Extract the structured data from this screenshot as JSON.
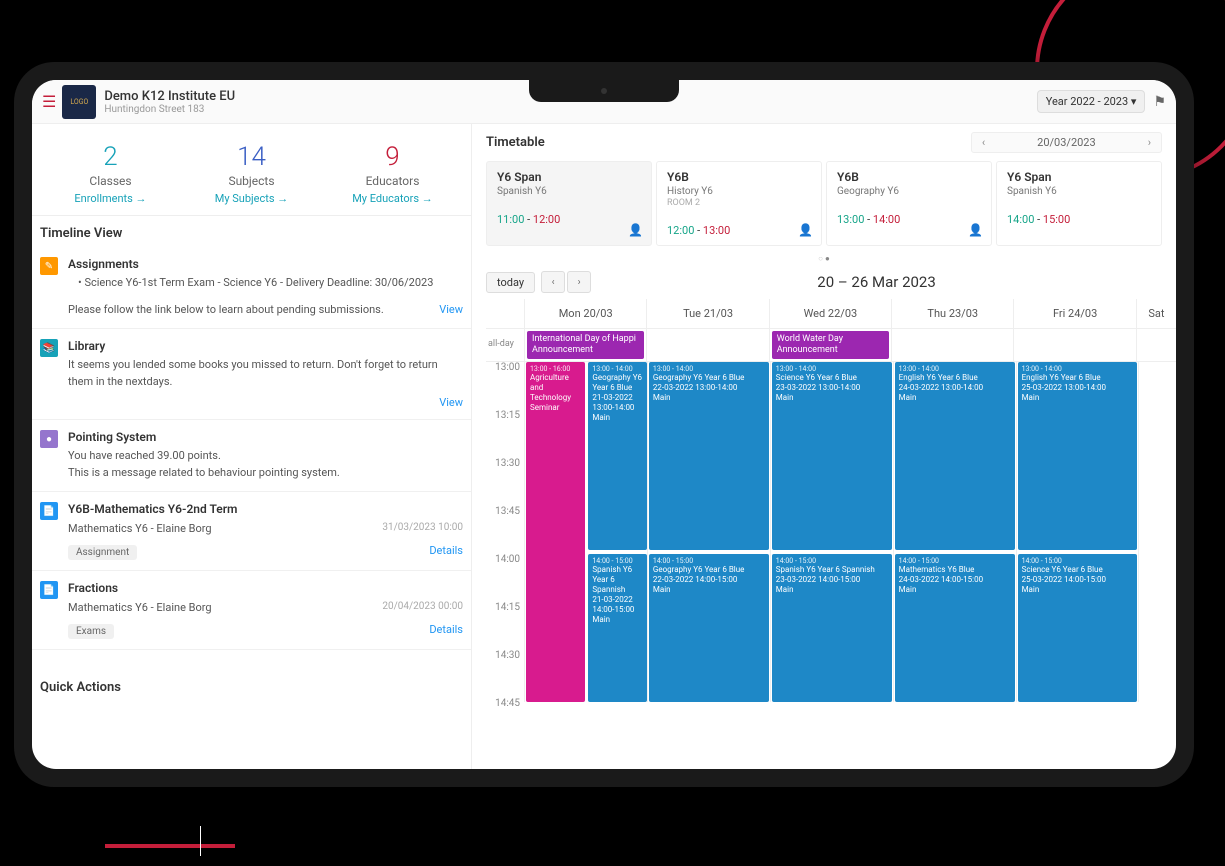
{
  "header": {
    "institute": "Demo K12 Institute EU",
    "address": "Huntingdon Street 183",
    "year_selector": "Year 2022 - 2023",
    "logo_text": "LOGO"
  },
  "stats": [
    {
      "value": "2",
      "label": "Classes",
      "link": "Enrollments",
      "color": "teal"
    },
    {
      "value": "14",
      "label": "Subjects",
      "link": "My Subjects",
      "color": "blue"
    },
    {
      "value": "9",
      "label": "Educators",
      "link": "My Educators",
      "color": "red"
    }
  ],
  "timeline_title": "Timeline View",
  "quick_actions_title": "Quick Actions",
  "timeline": [
    {
      "icon": "orange",
      "glyph": "✎",
      "title": "Assignments",
      "bullet": "• Science Y6-1st Term Exam - Science Y6 - Delivery Deadline: 30/06/2023",
      "note": "Please follow the link below to learn about pending submissions.",
      "action": "View"
    },
    {
      "icon": "tealbg",
      "glyph": "📚",
      "title": "Library",
      "text": "It seems you lended some books you missed to return. Don't forget to return them in the nextdays.",
      "action": "View"
    },
    {
      "icon": "purple",
      "glyph": "●",
      "title": "Pointing System",
      "line1": "You have reached 39.00 points.",
      "line2": "This is a message related to behaviour pointing system."
    },
    {
      "icon": "bluebg",
      "glyph": "📄",
      "title": "Y6B-Mathematics Y6-2nd Term",
      "subtitle": "Mathematics Y6 - Elaine Borg",
      "datetime": "31/03/2023 10:00",
      "tag": "Assignment",
      "action": "Details"
    },
    {
      "icon": "bluebg",
      "glyph": "📄",
      "title": "Fractions",
      "subtitle": "Mathematics Y6 - Elaine Borg",
      "datetime": "20/04/2023 00:00",
      "tag": "Exams",
      "action": "Details"
    }
  ],
  "timetable": {
    "title": "Timetable",
    "date": "20/03/2023",
    "slots": [
      {
        "class": "Y6 Span",
        "subject": "Spanish Y6",
        "room": "",
        "start": "11:00",
        "end": "12:00",
        "active": true
      },
      {
        "class": "Y6B",
        "subject": "History Y6",
        "room": "ROOM 2",
        "start": "12:00",
        "end": "13:00"
      },
      {
        "class": "Y6B",
        "subject": "Geography Y6",
        "room": "",
        "start": "13:00",
        "end": "14:00"
      },
      {
        "class": "Y6 Span",
        "subject": "Spanish Y6",
        "room": "",
        "start": "14:00",
        "end": "15:00"
      }
    ]
  },
  "calendar": {
    "today_label": "today",
    "range": "20 – 26 Mar 2023",
    "allday_label": "all-day",
    "days": [
      "Mon 20/03",
      "Tue 21/03",
      "Wed 22/03",
      "Thu 23/03",
      "Fri 24/03",
      "Sat"
    ],
    "times": [
      "13:00",
      "13:15",
      "13:30",
      "13:45",
      "14:00",
      "14:15",
      "14:30",
      "14:45"
    ],
    "allday_events": {
      "0": {
        "title": "International Day of Happi",
        "sub": "Announcement"
      },
      "2": {
        "title": "World Water Day",
        "sub": "Announcement"
      }
    },
    "events": {
      "mon_seminar": {
        "time": "13:00 - 16:00",
        "title": "Agriculture and Technology Seminar"
      },
      "mon_geo": {
        "time": "13:00 - 14:00",
        "title": "Geography Y6 Year 6 Blue",
        "details": "21-03-2022 13:00-14:00",
        "loc": "Main"
      },
      "mon_span": {
        "time": "14:00 - 15:00",
        "title": "Spanish Y6 Year 6 Spannish",
        "details": "21-03-2022 14:00-15:00",
        "loc": "Main"
      },
      "tue_geo": {
        "time": "13:00 - 14:00",
        "title": "Geography Y6 Year 6 Blue",
        "details": "22-03-2022 13:00-14:00",
        "loc": "Main"
      },
      "tue_geo2": {
        "time": "14:00 - 15:00",
        "title": "Geography Y6 Year 6 Blue",
        "details": "22-03-2022 14:00-15:00",
        "loc": "Main"
      },
      "wed_sci": {
        "time": "13:00 - 14:00",
        "title": "Science Y6 Year 6 Blue",
        "details": "23-03-2022 13:00-14:00",
        "loc": "Main"
      },
      "wed_span": {
        "time": "14:00 - 15:00",
        "title": "Spanish Y6 Year 6 Spannish",
        "details": "23-03-2022 14:00-15:00",
        "loc": "Main"
      },
      "thu_eng": {
        "time": "13:00 - 14:00",
        "title": "English Y6 Year 6 Blue",
        "details": "24-03-2022 13:00-14:00",
        "loc": "Main"
      },
      "thu_math": {
        "time": "14:00 - 15:00",
        "title": "Mathematics Y6 Blue",
        "details": "24-03-2022 14:00-15:00",
        "loc": "Main"
      },
      "fri_eng": {
        "time": "13:00 - 14:00",
        "title": "English Y6 Year 6 Blue",
        "details": "25-03-2022 13:00-14:00",
        "loc": "Main"
      },
      "fri_sci": {
        "time": "14:00 - 15:00",
        "title": "Science Y6 Year 6 Blue",
        "details": "25-03-2022 14:00-15:00",
        "loc": "Main"
      }
    }
  }
}
